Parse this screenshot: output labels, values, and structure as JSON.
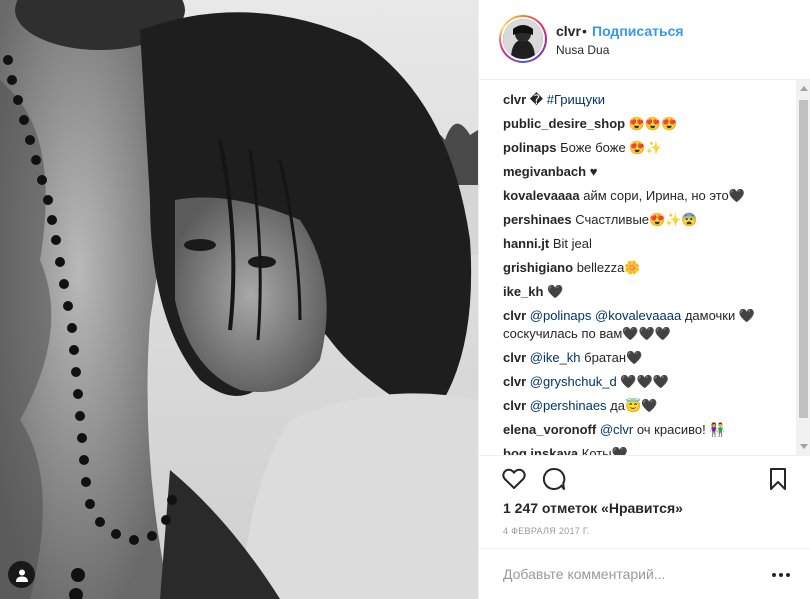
{
  "photo": {
    "alt_icon": "person-tag-icon"
  },
  "header": {
    "username": "clvr",
    "separator": "•",
    "follow_label": "Подписаться",
    "location": "Nusa Dua"
  },
  "comments": [
    {
      "author": "clvr",
      "parts": [
        {
          "t": "text",
          "v": "� "
        },
        {
          "t": "hashtag",
          "v": "#Грищуки"
        }
      ]
    },
    {
      "author": "public_desire_shop",
      "parts": [
        {
          "t": "text",
          "v": "😍😍😍"
        }
      ]
    },
    {
      "author": "polinaps",
      "parts": [
        {
          "t": "text",
          "v": "Боже боже 😍✨"
        }
      ]
    },
    {
      "author": "megivanbach",
      "parts": [
        {
          "t": "text",
          "v": "♥"
        }
      ]
    },
    {
      "author": "kovalevaaaa",
      "parts": [
        {
          "t": "text",
          "v": "айм сори, Ирина, но это🖤"
        }
      ]
    },
    {
      "author": "pershinaes",
      "parts": [
        {
          "t": "text",
          "v": "Счастливые😍✨😨"
        }
      ]
    },
    {
      "author": "hanni.jt",
      "parts": [
        {
          "t": "text",
          "v": "Bit jeal"
        }
      ]
    },
    {
      "author": "grishigiano",
      "parts": [
        {
          "t": "text",
          "v": "bellezza🌼"
        }
      ]
    },
    {
      "author": "ike_kh",
      "parts": [
        {
          "t": "text",
          "v": "🖤"
        }
      ]
    },
    {
      "author": "clvr",
      "parts": [
        {
          "t": "mention",
          "v": "@polinaps"
        },
        {
          "t": "text",
          "v": " "
        },
        {
          "t": "mention",
          "v": "@kovalevaaaa"
        },
        {
          "t": "text",
          "v": " дамочки 🖤 соскучилась по вам🖤🖤🖤"
        }
      ]
    },
    {
      "author": "clvr",
      "parts": [
        {
          "t": "mention",
          "v": "@ike_kh"
        },
        {
          "t": "text",
          "v": " братан🖤"
        }
      ]
    },
    {
      "author": "clvr",
      "parts": [
        {
          "t": "mention",
          "v": "@gryshchuk_d"
        },
        {
          "t": "text",
          "v": " 🖤🖤🖤"
        }
      ]
    },
    {
      "author": "clvr",
      "parts": [
        {
          "t": "mention",
          "v": "@pershinaes"
        },
        {
          "t": "text",
          "v": " да😇🖤"
        }
      ]
    },
    {
      "author": "elena_voronoff",
      "parts": [
        {
          "t": "mention",
          "v": "@clvr"
        },
        {
          "t": "text",
          "v": " оч красиво! 👫"
        }
      ]
    },
    {
      "author": "bog.inskaya",
      "parts": [
        {
          "t": "text",
          "v": "Коты🖤"
        }
      ]
    }
  ],
  "actions": {
    "like_icon": "heart-icon",
    "comment_icon": "comment-bubble-icon",
    "save_icon": "bookmark-icon"
  },
  "likes_text": "1 247 отметок «Нравится»",
  "date": "4 февраля 2017 г.",
  "add_comment": {
    "placeholder": "Добавьте комментарий...",
    "more_icon": "ellipsis-icon"
  },
  "colors": {
    "link": "#3897f0",
    "mention": "#003569",
    "text": "#262626",
    "muted": "#999999"
  }
}
